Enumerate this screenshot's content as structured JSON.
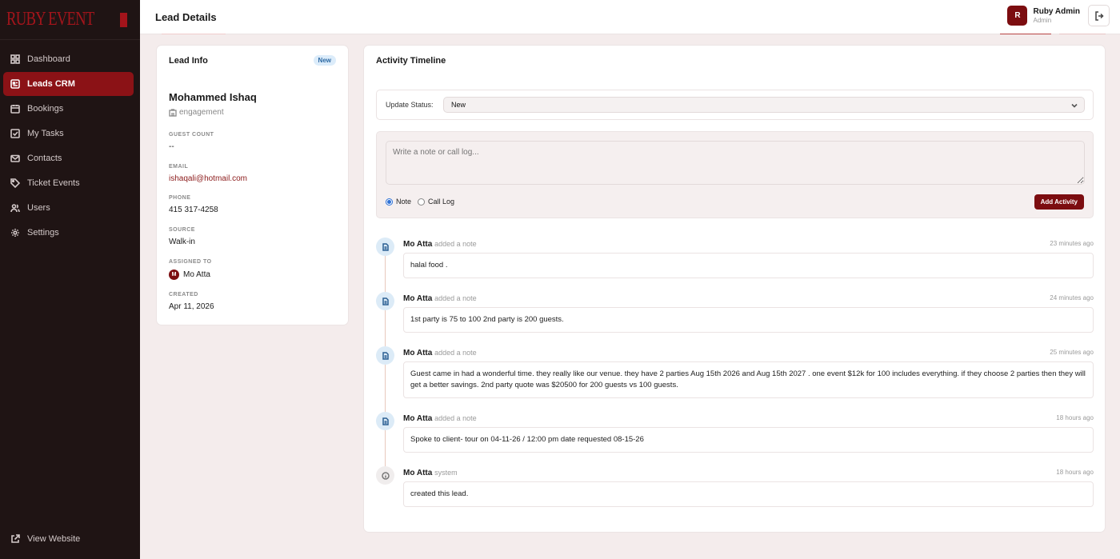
{
  "brand": {
    "logo_text": "RUBY EVENT"
  },
  "sidebar": {
    "items": [
      {
        "label": "Dashboard",
        "icon": "grid-icon"
      },
      {
        "label": "Leads CRM",
        "icon": "lead-card-icon",
        "active": true
      },
      {
        "label": "Bookings",
        "icon": "calendar-icon"
      },
      {
        "label": "My Tasks",
        "icon": "checkbox-icon"
      },
      {
        "label": "Contacts",
        "icon": "mail-icon"
      },
      {
        "label": "Ticket Events",
        "icon": "tag-icon"
      },
      {
        "label": "Users",
        "icon": "users-icon"
      },
      {
        "label": "Settings",
        "icon": "gear-icon"
      }
    ],
    "bottom_link": "View Website"
  },
  "header": {
    "title": "Lead Details",
    "user_initial": "R",
    "user_name": "Ruby Admin",
    "user_role": "Admin"
  },
  "lead": {
    "card_title": "Lead Info",
    "status_badge": "New",
    "name": "Mohammed Ishaq",
    "event_type": "engagement",
    "fields": {
      "guest_count_label": "GUEST COUNT",
      "guest_count": "--",
      "email_label": "EMAIL",
      "email": "ishaqali@hotmail.com",
      "phone_label": "PHONE",
      "phone": "415 317-4258",
      "source_label": "SOURCE",
      "source": "Walk-in",
      "assigned_label": "ASSIGNED TO",
      "assigned_initial": "M",
      "assigned_to": "Mo Atta",
      "created_label": "CREATED",
      "created": "Apr 11, 2026"
    }
  },
  "activity": {
    "title": "Activity Timeline",
    "status_label": "Update Status:",
    "status_value": "New",
    "note_placeholder": "Write a note or call log...",
    "radio_note": "Note",
    "radio_call": "Call Log",
    "add_button": "Add Activity",
    "entries": [
      {
        "author": "Mo Atta",
        "action": "added a note",
        "time": "23 minutes ago",
        "body": "halal food .",
        "kind": "note"
      },
      {
        "author": "Mo Atta",
        "action": "added a note",
        "time": "24 minutes ago",
        "body": "1st party is 75 to 100 2nd party is 200 guests.",
        "kind": "note"
      },
      {
        "author": "Mo Atta",
        "action": "added a note",
        "time": "25 minutes ago",
        "body": "Guest came in had a wonderful time. they really like our venue. they have 2 parties Aug 15th 2026 and Aug 15th 2027 . one event $12k for 100 includes everything. if they choose 2 parties then they will get a better savings. 2nd party quote was $20500 for 200 guests vs 100 guests.",
        "kind": "note"
      },
      {
        "author": "Mo Atta",
        "action": "added a note",
        "time": "18 hours ago",
        "body": "Spoke to client- tour on 04-11-26 / 12:00 pm date requested 08-15-26",
        "kind": "note"
      },
      {
        "author": "Mo Atta",
        "action": "system",
        "time": "18 hours ago",
        "body": "created this lead.",
        "kind": "system"
      }
    ]
  },
  "colors": {
    "accent": "#7c0d10",
    "sidebar_bg": "#1f1414",
    "page_bg": "#f4ecec"
  }
}
